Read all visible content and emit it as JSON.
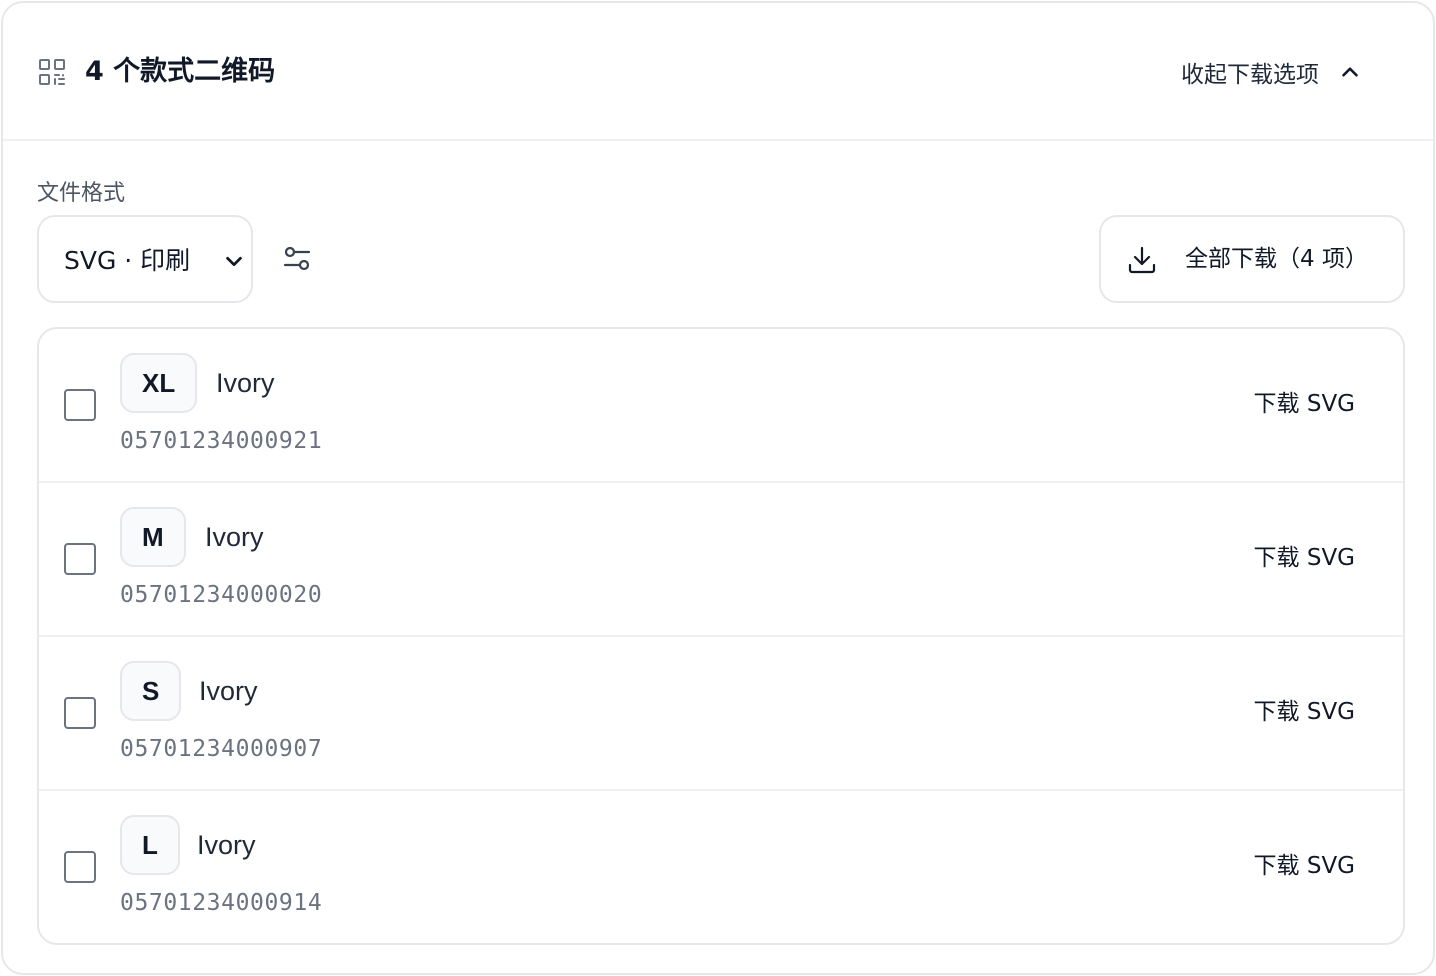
{
  "header": {
    "icon": "qr-code-icon",
    "title": "4 个款式二维码",
    "collapse_label": "收起下载选项",
    "collapse_icon": "chevron-up-icon"
  },
  "format": {
    "label": "文件格式",
    "selected": "SVG · 印刷",
    "options_icon": "sliders-icon"
  },
  "download_all": {
    "icon": "download-icon",
    "label": "全部下载（4 项）"
  },
  "items": [
    {
      "size": "XL",
      "color": "Ivory",
      "barcode": "05701234000921",
      "action": "下载 SVG",
      "checked": false
    },
    {
      "size": "M",
      "color": "Ivory",
      "barcode": "05701234000020",
      "action": "下载 SVG",
      "checked": false
    },
    {
      "size": "S",
      "color": "Ivory",
      "barcode": "05701234000907",
      "action": "下载 SVG",
      "checked": false
    },
    {
      "size": "L",
      "color": "Ivory",
      "barcode": "05701234000914",
      "action": "下载 SVG",
      "checked": false
    }
  ],
  "colors": {
    "border": "#e5e7eb",
    "text": "#111827",
    "muted": "#6b7280"
  }
}
